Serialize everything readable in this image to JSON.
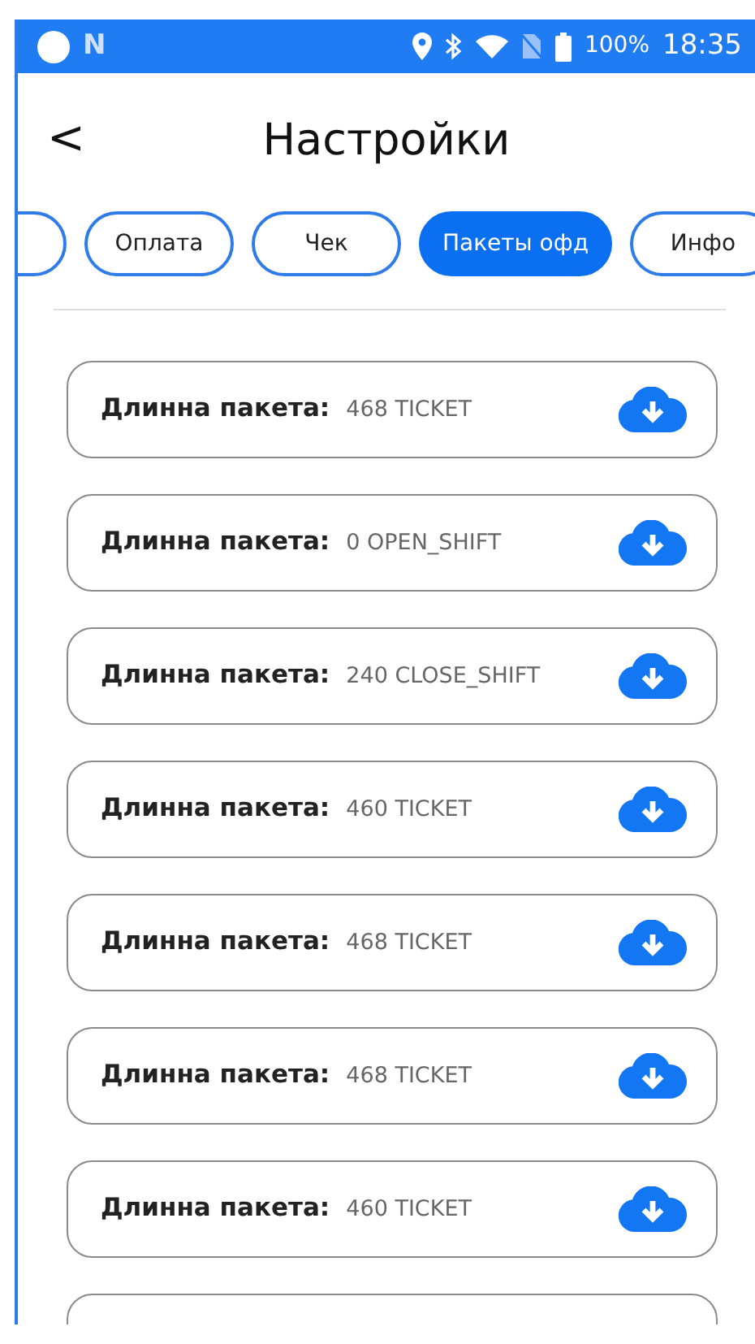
{
  "status_bar": {
    "notification_glyph": "N",
    "battery": "100%",
    "time": "18:35"
  },
  "header": {
    "back": "<",
    "title": "Настройки"
  },
  "tabs": [
    {
      "selected": false
    },
    {
      "label": "Оплата",
      "selected": false
    },
    {
      "label": "Чек",
      "selected": false
    },
    {
      "label": "Пакеты офд",
      "selected": true
    },
    {
      "label": "Инфо",
      "selected": false
    }
  ],
  "packets": [
    {
      "label": "Длинна пакета:",
      "value": "468 TICKET"
    },
    {
      "label": "Длинна пакета:",
      "value": "0 OPEN_SHIFT"
    },
    {
      "label": "Длинна пакета:",
      "value": "240 CLOSE_SHIFT"
    },
    {
      "label": "Длинна пакета:",
      "value": "460 TICKET"
    },
    {
      "label": "Длинна пакета:",
      "value": "468 TICKET"
    },
    {
      "label": "Длинна пакета:",
      "value": "468 TICKET"
    },
    {
      "label": "Длинна пакета:",
      "value": "460 TICKET"
    }
  ]
}
